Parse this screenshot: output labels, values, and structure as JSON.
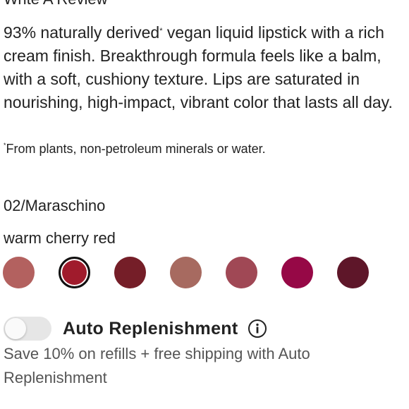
{
  "header": {
    "title": "Write A Review"
  },
  "product": {
    "description": "93% naturally derived",
    "description_mark": "*",
    "description_rest": " vegan liquid lipstick with a rich cream finish. Breakthrough formula feels like a balm, with a soft, cushiony texture. Lips are saturated in nourishing, high-impact, vibrant color that lasts all day.",
    "footnote_mark": "*",
    "footnote": "From plants, non-petroleum minerals or water."
  },
  "shade": {
    "name": "02/Maraschino",
    "description": "warm cherry red",
    "swatches": [
      {
        "color": "#b3615f",
        "selected": false
      },
      {
        "color": "#a01b2c",
        "selected": true
      },
      {
        "color": "#751e28",
        "selected": false
      },
      {
        "color": "#a76a60",
        "selected": false
      },
      {
        "color": "#a04855",
        "selected": false
      },
      {
        "color": "#960846",
        "selected": false
      },
      {
        "color": "#5e1629",
        "selected": false
      }
    ]
  },
  "auto_replenishment": {
    "label": "Auto Replenishment",
    "enabled": false,
    "info_icon": "info-icon",
    "promo": "Save 10% on refills + free shipping with Auto Replenishment"
  }
}
